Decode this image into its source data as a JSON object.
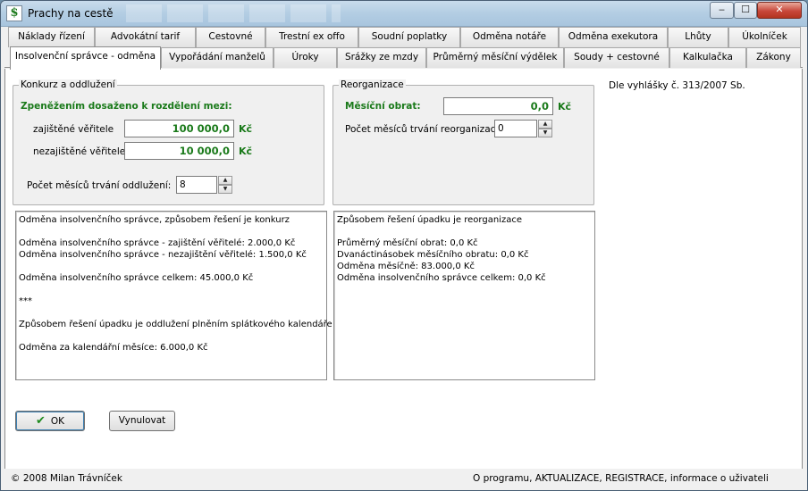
{
  "window": {
    "title": "Prachy na cestě",
    "app_icon": "$",
    "buttons": {
      "minimize": "‒",
      "maximize": "☐",
      "close": "✕"
    }
  },
  "tabs": {
    "row1": [
      "Náklady řízení",
      "Advokátní tarif",
      "Cestovné",
      "Trestní ex offo",
      "Soudní poplatky",
      "Odměna notáře",
      "Odměna exekutora",
      "Lhůty",
      "Úkolníček"
    ],
    "row2": [
      "Insolvenční správce - odměna",
      "Vypořádání manželů",
      "Úroky",
      "Srážky ze mzdy",
      "Průměrný měsíční výdělek",
      "Soudy + cestovné",
      "Kalkulačka",
      "Zákony"
    ]
  },
  "konkurz": {
    "legend": "Konkurz a oddlužení",
    "heading": "Zpeněžením dosaženo k rozdělení mezi:",
    "secured_label": "zajištěné věřitele",
    "secured_value": "100 000,0",
    "unsecured_label": "nezajištěné věřitele",
    "unsecured_value": "10 000,0",
    "unit": "Kč",
    "months_label": "Počet měsíců trvání oddlužení:",
    "months_value": "8"
  },
  "reorganizace": {
    "legend": "Reorganizace",
    "turnover_label": "Měsíční obrat:",
    "turnover_value": "0,0",
    "unit": "Kč",
    "months_label": "Počet měsíců trvání reorganizace",
    "months_value": "0"
  },
  "regulation": "Dle vyhlášky č. 313/2007 Sb.",
  "result_left": [
    "Odměna insolvenčního správce, způsobem řešení je konkurz",
    "",
    "Odměna insolvenčního správce - zajištění věřitelé: 2.000,0 Kč",
    "Odměna insolvenčního správce - nezajištění věřitelé: 1.500,0 Kč",
    "",
    "Odměna insolvenčního správce celkem: 45.000,0 Kč",
    "",
    "***",
    "",
    "Způsobem řešení úpadku je oddlužení plněním splátkového kalendáře",
    "",
    "Odměna za kalendářní měsíce: 6.000,0 Kč"
  ],
  "result_right": [
    "Způsobem řešení úpadku je reorganizace",
    "",
    "Průměrný měsíční obrat: 0,0 Kč",
    "Dvanáctinásobek měsíčního obratu: 0,0 Kč",
    "Odměna měsíčně: 83.000,0 Kč",
    "Odměna insolvenčního správce celkem: 0,0 Kč"
  ],
  "buttons": {
    "ok": "OK",
    "reset": "Vynulovat"
  },
  "status": {
    "copyright": "© 2008 Milan Trávníček",
    "links": "O programu, AKTUALIZACE, REGISTRACE, informace o uživateli"
  },
  "colors": {
    "accent_green": "#1a7a1a",
    "close_red": "#c8473a",
    "title_blue": "#b3cde3"
  }
}
